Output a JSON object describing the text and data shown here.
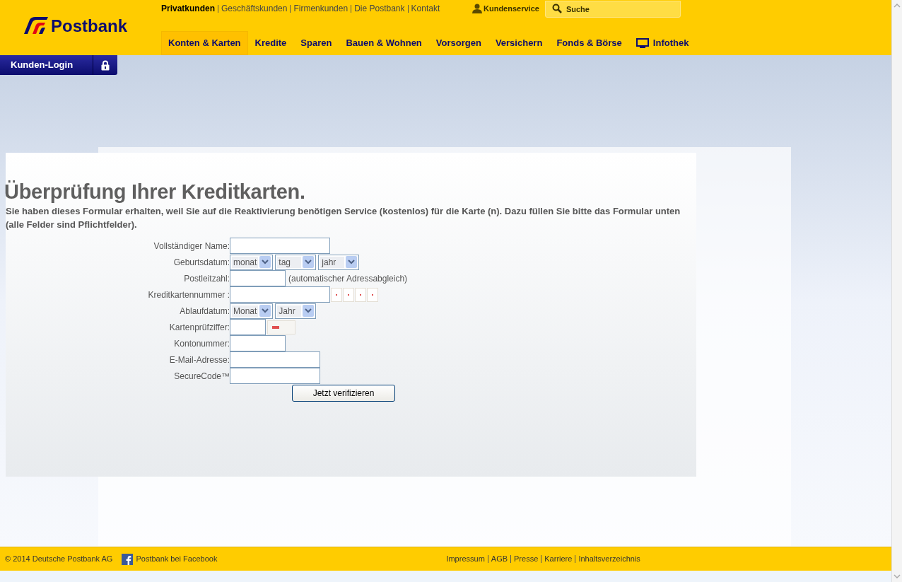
{
  "header": {
    "logo_text": "Postbank",
    "top_links": [
      {
        "label": "Privatkunden",
        "selected": true
      },
      {
        "label": "Geschäftskunden",
        "selected": false
      },
      {
        "label": "Firmenkunden",
        "selected": false
      },
      {
        "label": "Die Postbank",
        "selected": false
      },
      {
        "label": "Kontakt",
        "selected": false
      }
    ],
    "kundenservice": "Kundenservice",
    "search": {
      "placeholder": "Suche"
    },
    "nav": [
      {
        "label": "Konten & Karten",
        "selected": true,
        "kind": "plain"
      },
      {
        "label": "Kredite",
        "selected": false,
        "kind": "plain"
      },
      {
        "label": "Sparen",
        "selected": false,
        "kind": "plain"
      },
      {
        "label": "Bauen & Wohnen",
        "selected": false,
        "kind": "plain"
      },
      {
        "label": "Vorsorgen",
        "selected": false,
        "kind": "plain"
      },
      {
        "label": "Versichern",
        "selected": false,
        "kind": "plain"
      },
      {
        "label": "Fonds & Börse",
        "selected": false,
        "kind": "plain"
      },
      {
        "label": "Infothek",
        "selected": false,
        "kind": "screen"
      }
    ]
  },
  "login": {
    "label": "Kunden-Login"
  },
  "form": {
    "title": "Überprüfung Ihrer Kreditkarten.",
    "intro": "Sie haben dieses Formular erhalten, weil Sie auf die Reaktivierung benötigen Service (kostenlos) für die Karte (n). Dazu füllen Sie bitte das Formular unten (alle Felder sind Pflichtfelder).",
    "fields": [
      {
        "label": "Vollständiger Name:",
        "kind": "wide"
      },
      {
        "label": "Geburtsdatum:",
        "kind": "selects",
        "options": [
          "monat",
          "tag",
          "jahr"
        ]
      },
      {
        "label": "Postleitzahl:",
        "kind": "short",
        "note": "(automatischer Adressabgleich)"
      },
      {
        "label": "Kreditkartennummer :",
        "kind": "card"
      },
      {
        "label": "Ablaufdatum:",
        "kind": "selects",
        "options": [
          "Monat",
          "Jahr"
        ]
      },
      {
        "label": "Kartenprüfziffer:",
        "kind": "cvv"
      },
      {
        "label": "Kontonummer:",
        "kind": "short"
      },
      {
        "label": "E-Mail-Adresse:",
        "kind": "medium"
      },
      {
        "label": "SecureCode™",
        "kind": "medium"
      }
    ],
    "submit": "Jetzt verifizieren"
  },
  "footer": {
    "copyright": "© 2014 Deutsche Postbank AG",
    "facebook": "Postbank bei Facebook",
    "links": [
      "Impressum",
      "AGB",
      "Presse",
      "Karriere",
      "Inhaltsverzeichnis"
    ]
  }
}
